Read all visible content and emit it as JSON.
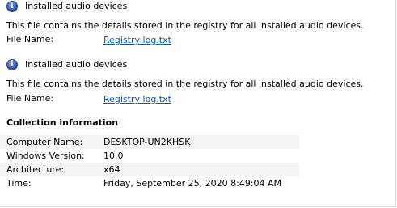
{
  "entries": [
    {
      "title": "Installed audio devices",
      "description": "This file contains the details stored in the registry for all installed audio devices.",
      "file_label": "File Name:",
      "file_link": "Registry log.txt",
      "icon": "info-icon"
    },
    {
      "title": "Installed audio devices",
      "description": "This file contains the details stored in the registry for all installed audio devices.",
      "file_label": "File Name:",
      "file_link": "Registry log.txt",
      "icon": "info-icon"
    }
  ],
  "collection": {
    "heading": "Collection information",
    "rows": [
      {
        "label": "Computer Name:",
        "value": "DESKTOP-UN2KHSK"
      },
      {
        "label": "Windows Version:",
        "value": "10.0"
      },
      {
        "label": "Architecture:",
        "value": "x64"
      },
      {
        "label": "Time:",
        "value": "Friday, September 25, 2020 8:49:04 AM"
      }
    ]
  },
  "colors": {
    "link": "#0055cc",
    "icon": "#3a62b8",
    "row_band": "#f4f4f4"
  }
}
